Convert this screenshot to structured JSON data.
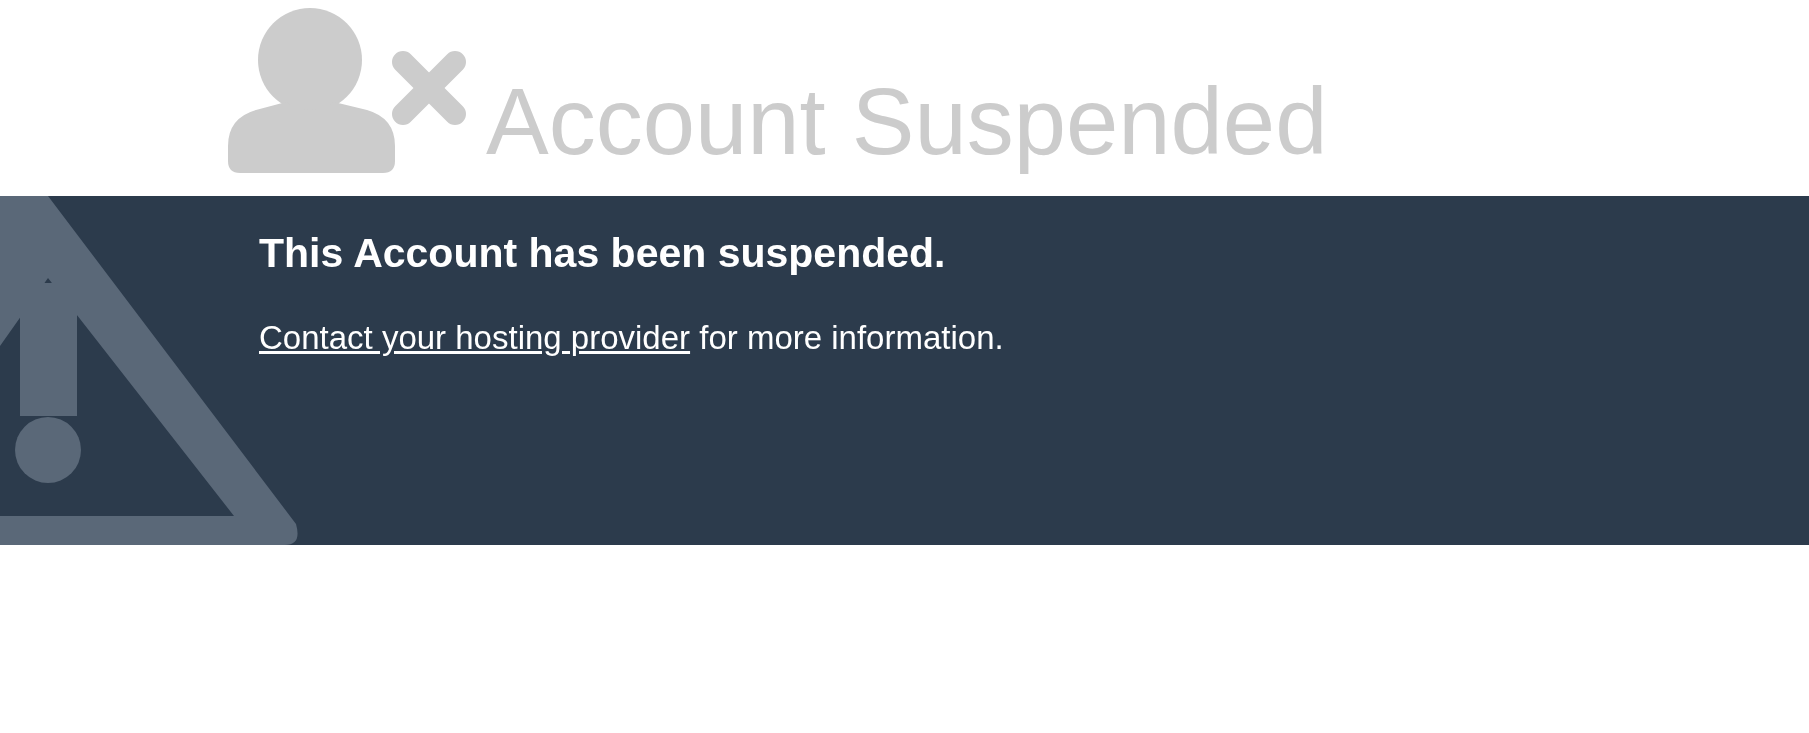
{
  "header": {
    "title": "Account Suspended"
  },
  "banner": {
    "heading": "This Account has been suspended.",
    "link": "Contact your hosting provider",
    "message": " for more information."
  }
}
